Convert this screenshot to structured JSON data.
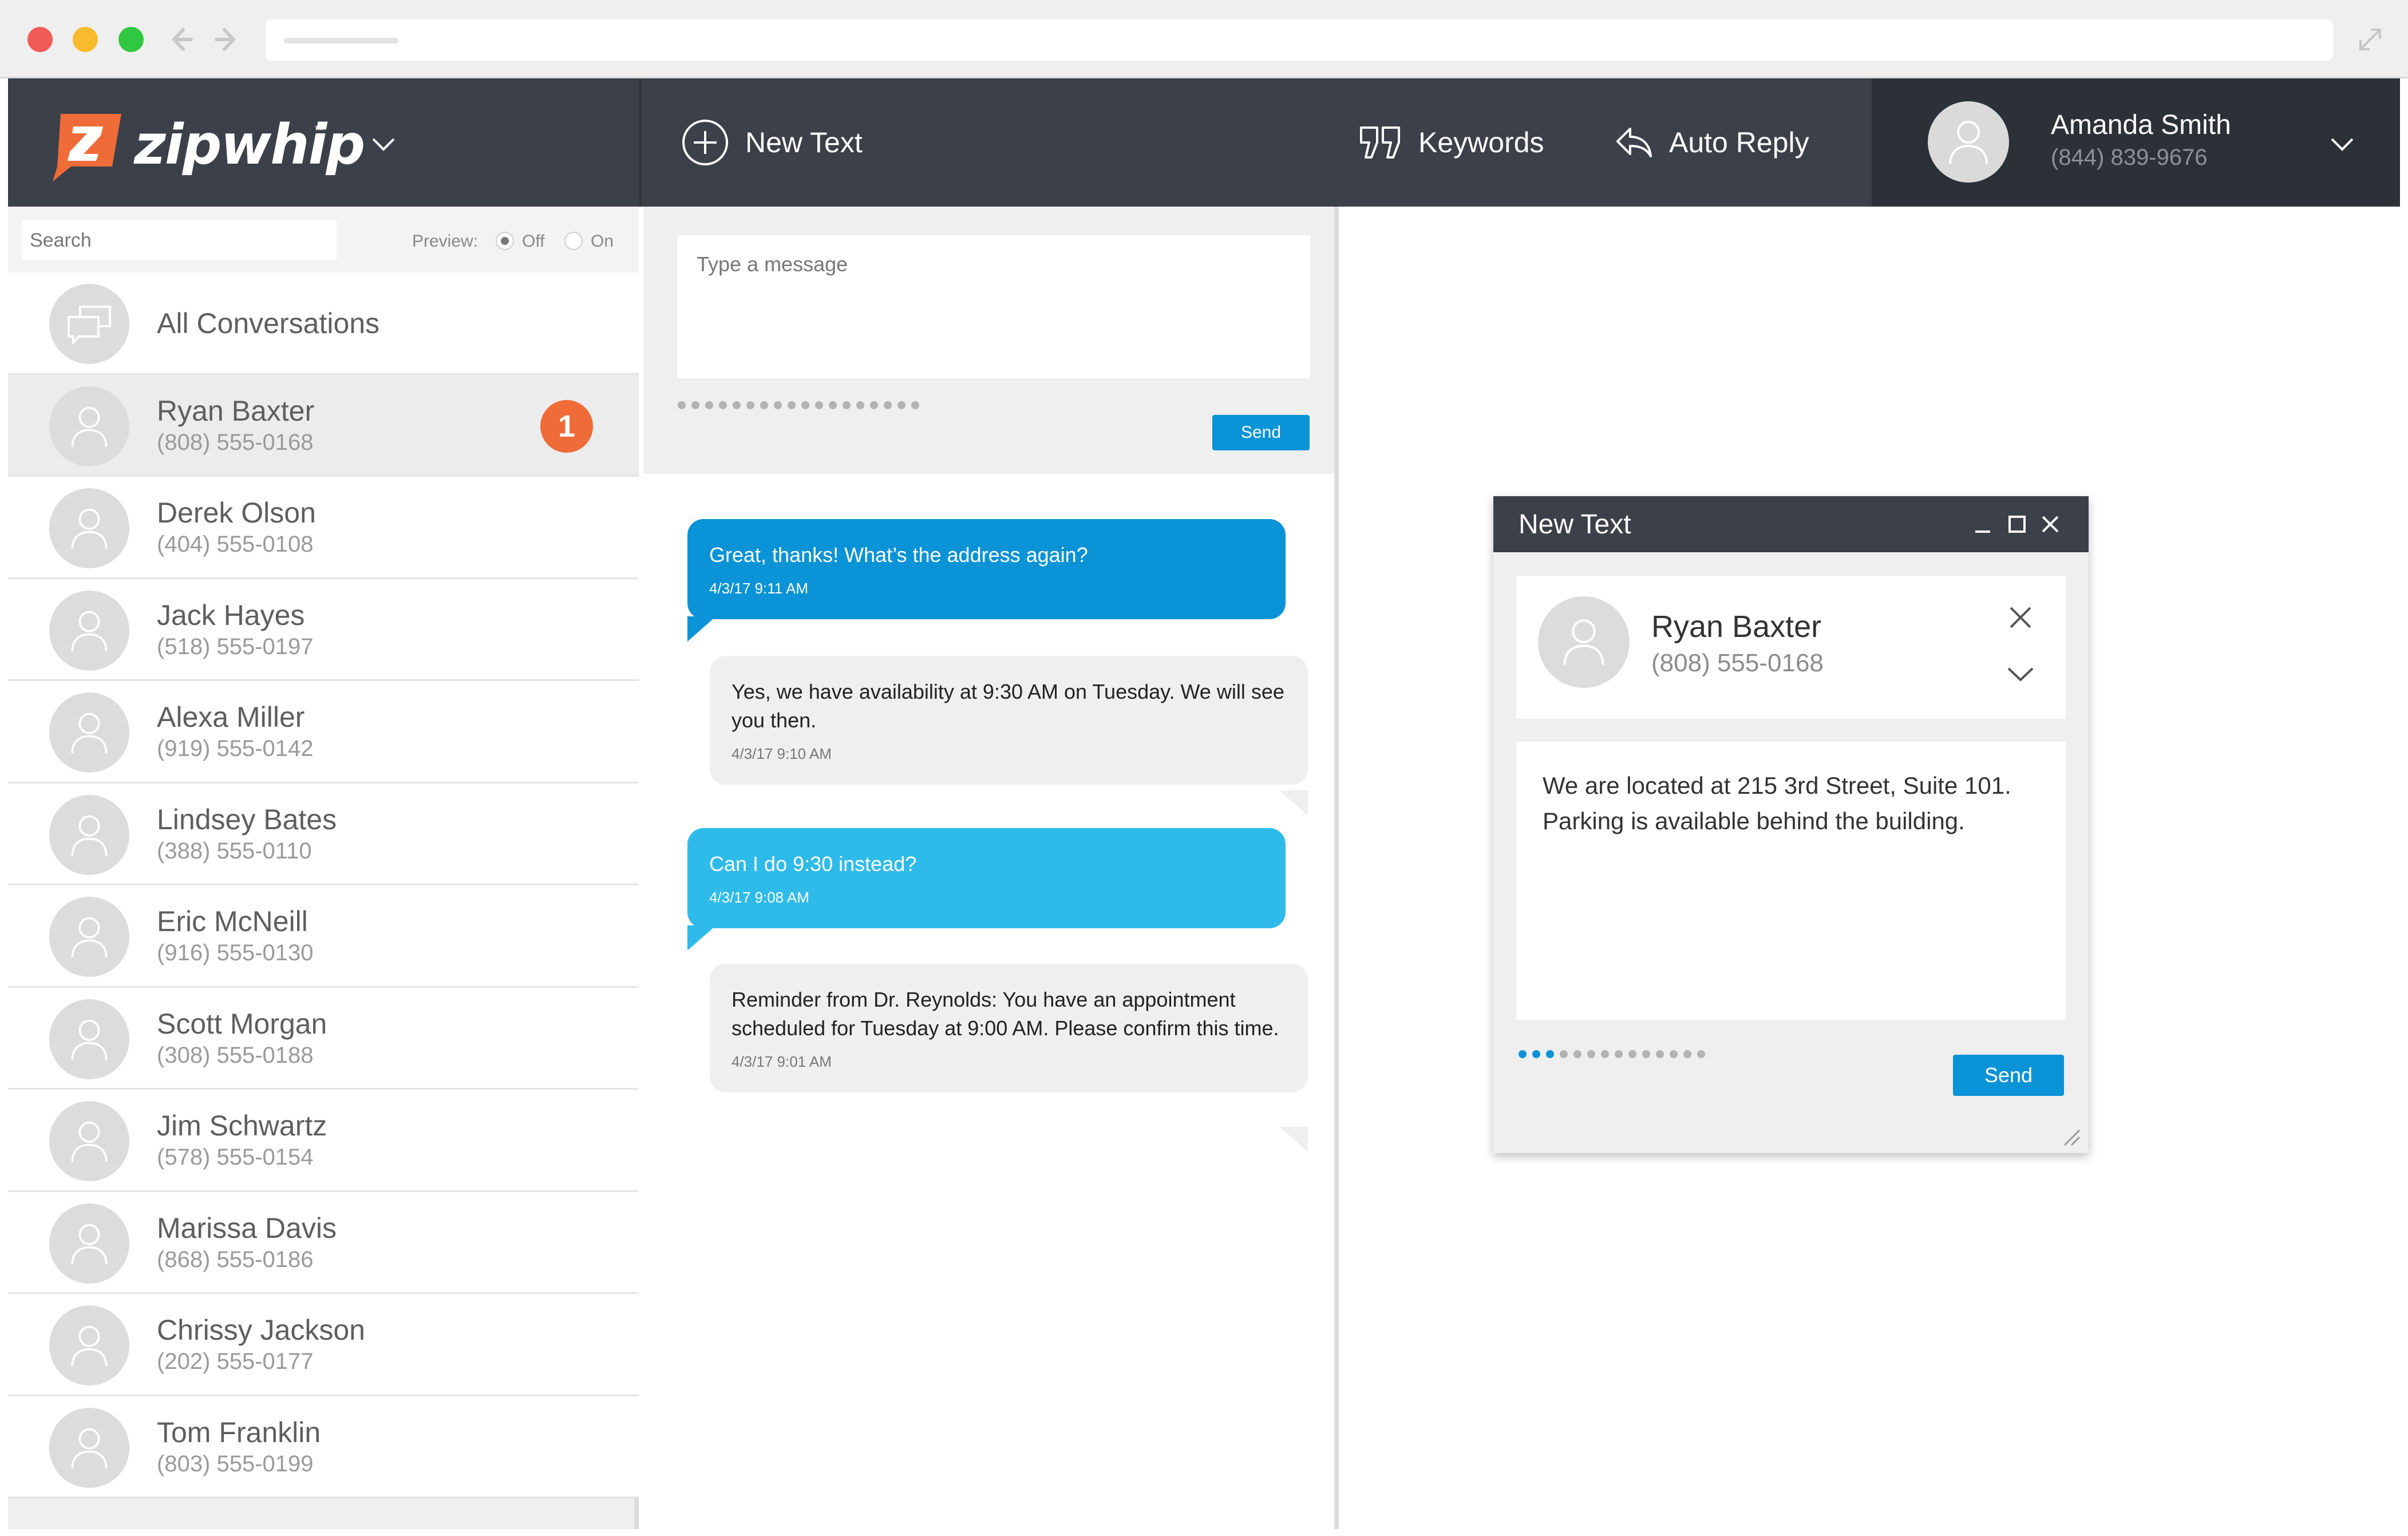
{
  "app": {
    "logo_text": "zipwhip",
    "logo_tm": "™"
  },
  "header": {
    "new_text_label": "New Text",
    "keywords_label": "Keywords",
    "auto_reply_label": "Auto Reply",
    "user": {
      "name": "Amanda Smith",
      "phone": "(844) 839-9676"
    }
  },
  "sidebar": {
    "search_placeholder": "Search",
    "preview_label": "Preview:",
    "preview_off": "Off",
    "preview_on": "On",
    "all_conversations": "All Conversations",
    "conversations": [
      {
        "name": "Ryan Baxter",
        "phone": "(808) 555-0168",
        "unread": "1",
        "active": true
      },
      {
        "name": "Derek Olson",
        "phone": "(404) 555-0108"
      },
      {
        "name": "Jack Hayes",
        "phone": "(518) 555-0197"
      },
      {
        "name": "Alexa Miller",
        "phone": "(919) 555-0142"
      },
      {
        "name": "Lindsey Bates",
        "phone": "(388) 555-0110"
      },
      {
        "name": "Eric McNeill",
        "phone": "(916) 555-0130"
      },
      {
        "name": "Scott Morgan",
        "phone": "(308) 555-0188"
      },
      {
        "name": "Jim Schwartz",
        "phone": "(578) 555-0154"
      },
      {
        "name": "Marissa Davis",
        "phone": "(868) 555-0186"
      },
      {
        "name": "Chrissy Jackson",
        "phone": "(202) 555-0177"
      },
      {
        "name": "Tom Franklin",
        "phone": "(803) 555-0199"
      }
    ]
  },
  "composer": {
    "placeholder": "Type a message",
    "send_label": "Send"
  },
  "messages": [
    {
      "text": "Great, thanks! What’s the address again?",
      "time": "4/3/17  9:11 AM"
    },
    {
      "text": "Yes, we have availability at 9:30 AM on Tuesday. We will see you then.",
      "time": "4/3/17  9:10 AM"
    },
    {
      "text": "Can I do 9:30 instead?",
      "time": "4/3/17  9:08 AM"
    },
    {
      "text": "Reminder from Dr. Reynolds: You have an appointment scheduled for Tuesday at 9:00 AM. Please confirm this time.",
      "time": "4/3/17  9:01 AM"
    }
  ],
  "popup": {
    "title": "New Text",
    "recipient_name": "Ryan Baxter",
    "recipient_phone": "(808) 555-0168",
    "message": "We are located at 215 3rd Street, Suite 101. Parking is available behind the building.",
    "send_label": "Send"
  },
  "colors": {
    "header_bg": "#3b4049",
    "accent_blue": "#0a93d6",
    "light_blue": "#2fbbea",
    "badge_orange": "#ef6b37"
  }
}
